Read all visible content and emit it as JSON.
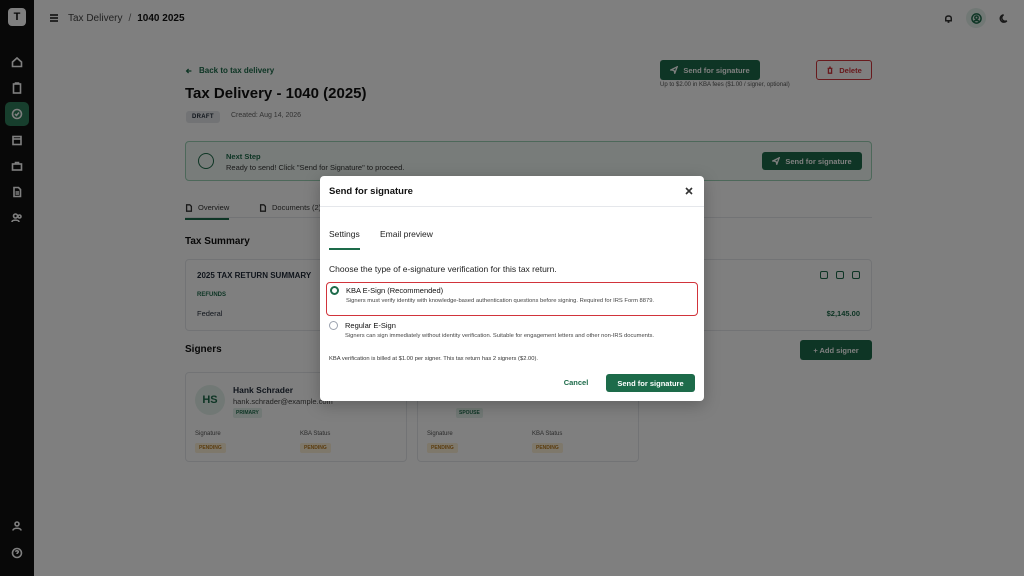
{
  "colors": {
    "brand": "#1d6b4a",
    "danger": "#d1343b",
    "rail": "#111111"
  },
  "rail": {
    "logo_icon": "app-logo-icon",
    "items": [
      "home-icon",
      "clipboard-icon",
      "tax-delivery-icon",
      "calendar-icon",
      "briefcase-icon",
      "document-icon",
      "users-icon"
    ],
    "bottom": [
      "user-icon",
      "help-icon"
    ]
  },
  "topbar": {
    "breadcrumb_parent": "Tax Delivery",
    "breadcrumb_sep": "/",
    "breadcrumb_current": "1040 2025"
  },
  "page": {
    "back_link": "Back to tax delivery",
    "title": "Tax Delivery - 1040 (2025)",
    "status": "DRAFT",
    "created": "Created: Aug 14, 2026",
    "send_button": "Send for signature",
    "fee_note": "Up to $2.00 in KBA fees ($1.00 / signer, optional)",
    "delete_button": "Delete",
    "next_step": {
      "title": "Next Step",
      "description": "Ready to send! Click \"Send for Signature\" to proceed.",
      "button": "Send for signature"
    },
    "tabs": [
      "Overview",
      "Documents (2)"
    ],
    "tax_summary": {
      "heading": "Tax Summary",
      "card_title": "2025 TAX RETURN SUMMARY",
      "refunds_label": "REFUNDS",
      "federal_label": "Federal",
      "federal_amount": "$2,145.00"
    },
    "signers": {
      "heading": "Signers",
      "add_button": "+ Add signer",
      "labels": {
        "signature": "Signature",
        "kba": "KBA Status",
        "pending": "PENDING"
      },
      "list": [
        {
          "initials": "HS",
          "name": "Hank Schrader",
          "email": "hank.schrader@example.com",
          "role": "PRIMARY"
        },
        {
          "initials": "",
          "name": "",
          "email": "",
          "role": "SPOUSE"
        }
      ]
    }
  },
  "modal": {
    "title": "Send for signature",
    "tabs": [
      "Settings",
      "Email preview"
    ],
    "instruction": "Choose the type of e-signature verification for this tax return.",
    "options": [
      {
        "title": "KBA E-Sign (Recommended)",
        "description": "Signers must verify identity with knowledge-based authentication questions before signing. Required for IRS Form 8879.",
        "selected": true
      },
      {
        "title": "Regular E-Sign",
        "description": "Signers can sign immediately without identity verification. Suitable for engagement letters and other non-IRS documents.",
        "selected": false
      }
    ],
    "billing_note": "KBA verification is billed at $1.00 per signer. This tax return has 2 signers ($2.00).",
    "cancel_button": "Cancel",
    "send_button": "Send for signature"
  }
}
